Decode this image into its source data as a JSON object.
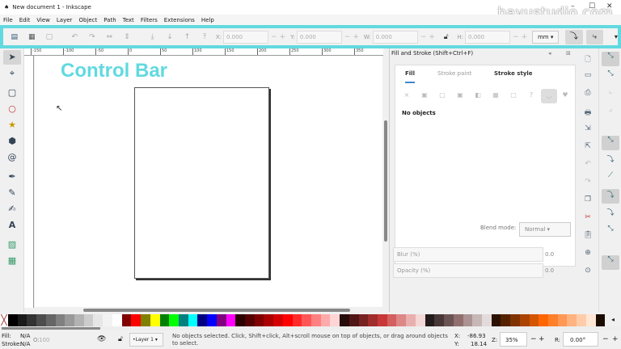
{
  "window": {
    "title": "New document 1 - Inkscape",
    "watermark": "bayustudio.com",
    "minimize": "–",
    "maximize": "☐",
    "close": "✕"
  },
  "menu": [
    "File",
    "Edit",
    "View",
    "Layer",
    "Object",
    "Path",
    "Text",
    "Filters",
    "Extensions",
    "Help"
  ],
  "control_bar": {
    "x": {
      "label": "X:",
      "value": "0.000"
    },
    "y": {
      "label": "Y:",
      "value": "0.000"
    },
    "w": {
      "label": "W:",
      "value": "0.000"
    },
    "h": {
      "label": "H:",
      "value": "0.000"
    },
    "units": "mm ▾",
    "minus": "−",
    "plus": "+",
    "more": "▾"
  },
  "annotation": "Control Bar",
  "ruler_ticks": [
    "-150",
    "-100",
    "-50",
    "0",
    "50",
    "100",
    "150",
    "200",
    "250",
    "300",
    "350"
  ],
  "dock": {
    "title": "Fill and Stroke (Shift+Ctrl+F)",
    "tabs": [
      "Fill",
      "Stroke paint",
      "Stroke style"
    ],
    "no_objects": "No objects",
    "blend_label": "Blend mode:",
    "blend_value": "Normal ▾",
    "blur_label": "Blur (%)",
    "blur_value": "0.0",
    "opacity_label": "Opacity (%)",
    "opacity_value": "0.0"
  },
  "palette": [
    "#000000",
    "#1a1a1a",
    "#333333",
    "#4d4d4d",
    "#666666",
    "#808080",
    "#999999",
    "#b3b3b3",
    "#cccccc",
    "#e6e6e6",
    "#f2f2f2",
    "#ffffff",
    "#800000",
    "#ff0000",
    "#808000",
    "#ffff00",
    "#008000",
    "#00ff00",
    "#008080",
    "#00ffff",
    "#000080",
    "#0000ff",
    "#800080",
    "#ff00ff",
    "#2b0000",
    "#550000",
    "#800000",
    "#aa0000",
    "#d40000",
    "#ff0000",
    "#ff2a2a",
    "#ff5555",
    "#ff8080",
    "#ffaaaa",
    "#ffd5d5",
    "#280b0b",
    "#501616",
    "#782121",
    "#a02c2c",
    "#c83737",
    "#d35f5f",
    "#de8787",
    "#e9afaf",
    "#f4d7d7",
    "#241c1c",
    "#483737",
    "#6c5353",
    "#916f6f",
    "#ac9393",
    "#c8b7b7",
    "#e3dbdb",
    "#2b1100",
    "#552200",
    "#803300",
    "#aa4400",
    "#d45500",
    "#ff6600",
    "#ff7f2a",
    "#ff9955",
    "#ffb380",
    "#ffccaa",
    "#ffe6d5",
    "#1a0d00"
  ],
  "status": {
    "fill_label": "Fill:",
    "fill_value": "N/A",
    "stroke_label": "Stroke:",
    "stroke_value": "N/A",
    "opacity_label": "O:",
    "opacity_value": "100",
    "layer": "•Layer 1 ▾",
    "message": "No objects selected. Click, Shift+click, Alt+scroll mouse on top of objects, or drag around objects to select.",
    "x_label": "X:",
    "x_value": "-86.93",
    "y_label": "Y:",
    "y_value": "18.14",
    "zoom_label": "Z:",
    "zoom_value": "35%",
    "rotate_label": "R:",
    "rotate_value": "0.00°"
  }
}
